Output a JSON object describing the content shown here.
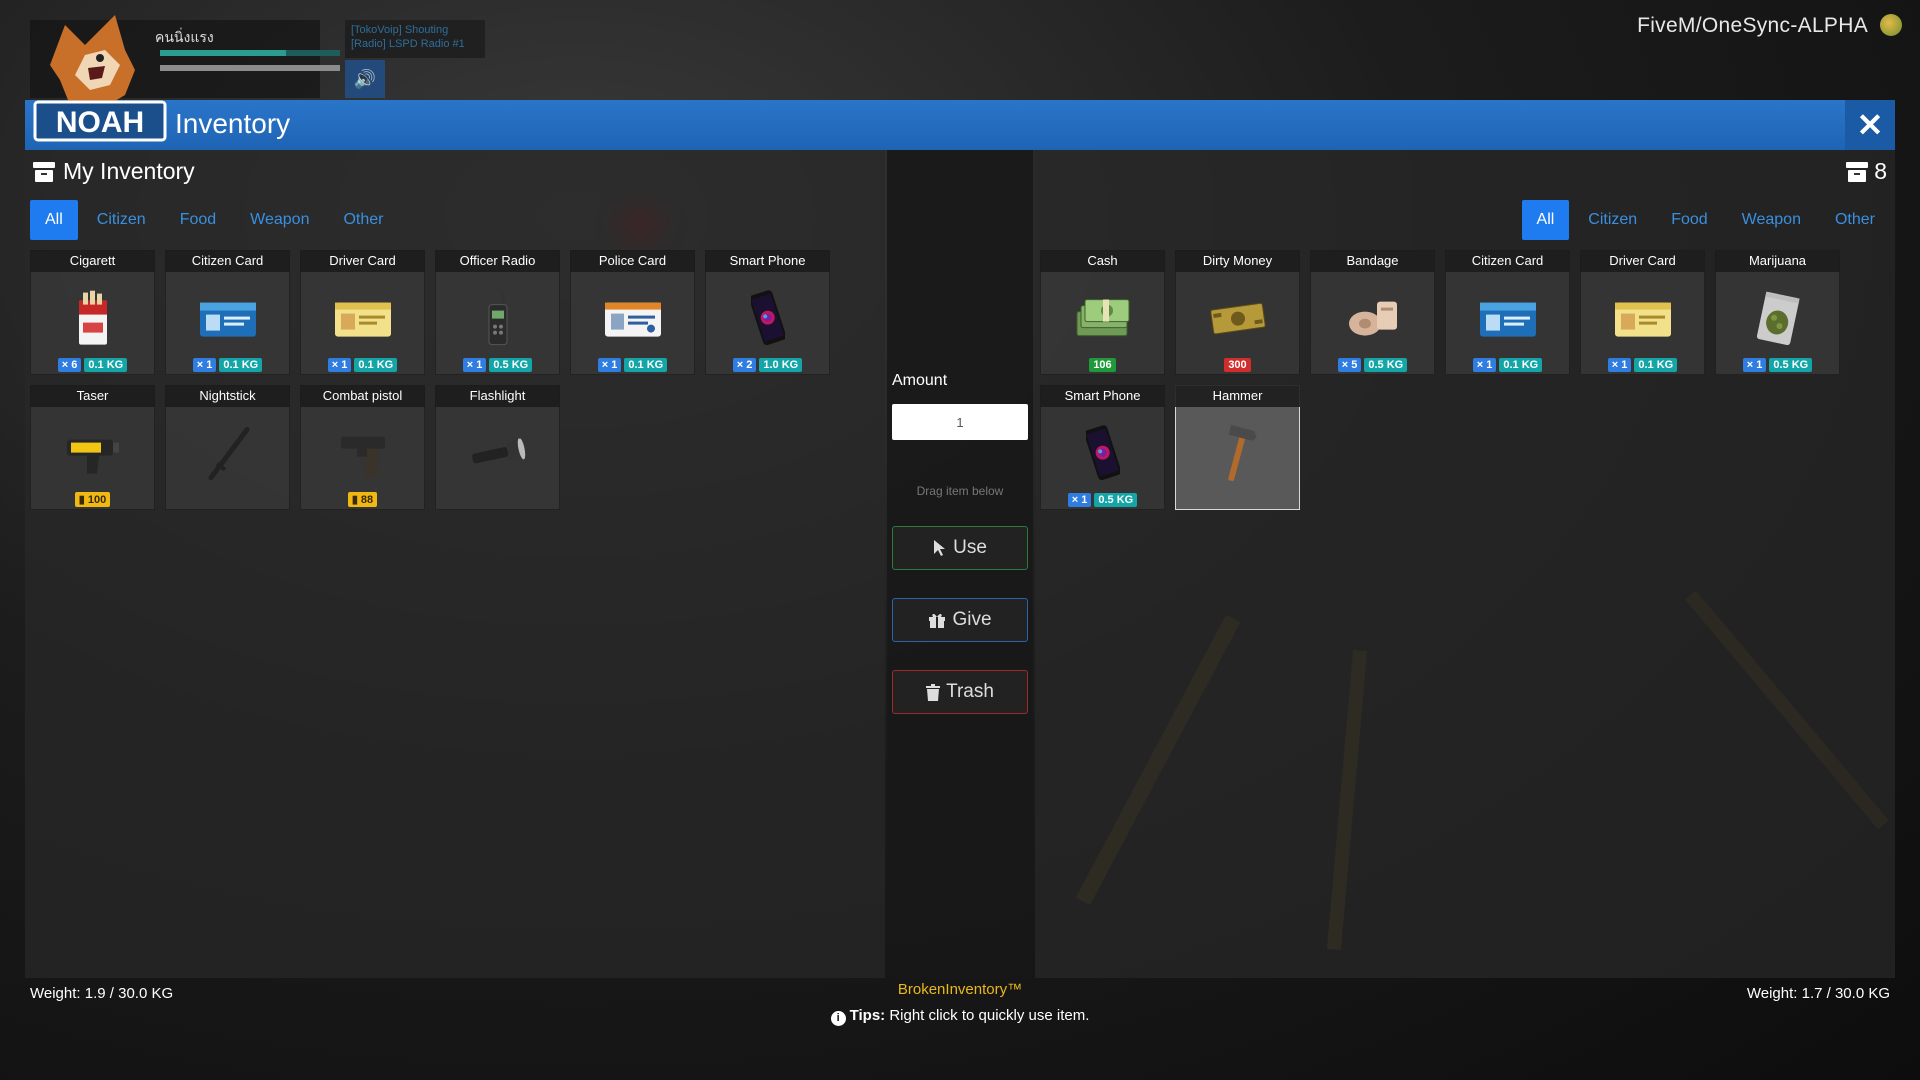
{
  "hud": {
    "player_name": "คนนิ่งแรง",
    "voice_line1": "[TokoVoip] Shouting",
    "voice_line2": "[Radio] LSPD Radio #1",
    "server_name": "FiveM/OneSync-ALPHA"
  },
  "logo": {
    "text": "NOAH"
  },
  "header": {
    "title": "Inventory",
    "close_label": "✕"
  },
  "left": {
    "title": "My Inventory",
    "tabs": [
      "All",
      "Citizen",
      "Food",
      "Weapon",
      "Other"
    ],
    "active_tab": "All",
    "weight": "Weight: 1.9 / 30.0 KG",
    "items": [
      {
        "name": "Cigarett",
        "icon": "cigarette-pack-icon",
        "qty": "× 6",
        "weight": "0.1 KG"
      },
      {
        "name": "Citizen Card",
        "icon": "citizen-card-icon",
        "qty": "× 1",
        "weight": "0.1 KG"
      },
      {
        "name": "Driver Card",
        "icon": "driver-card-icon",
        "qty": "× 1",
        "weight": "0.1 KG"
      },
      {
        "name": "Officer Radio",
        "icon": "radio-icon",
        "qty": "× 1",
        "weight": "0.5 KG"
      },
      {
        "name": "Police Card",
        "icon": "police-card-icon",
        "qty": "× 1",
        "weight": "0.1 KG"
      },
      {
        "name": "Smart Phone",
        "icon": "smartphone-icon",
        "qty": "× 2",
        "weight": "1.0 KG"
      },
      {
        "name": "Taser",
        "icon": "taser-icon",
        "ammo": "100"
      },
      {
        "name": "Nightstick",
        "icon": "nightstick-icon"
      },
      {
        "name": "Combat pistol",
        "icon": "pistol-icon",
        "ammo": "88"
      },
      {
        "name": "Flashlight",
        "icon": "flashlight-icon"
      }
    ]
  },
  "middle": {
    "amount_label": "Amount",
    "amount_value": "1",
    "drag_hint": "Drag item below",
    "use_label": "Use",
    "give_label": "Give",
    "trash_label": "Trash",
    "brand": "BrokenInventory™"
  },
  "right": {
    "count": "8",
    "tabs": [
      "All",
      "Citizen",
      "Food",
      "Weapon",
      "Other"
    ],
    "active_tab": "All",
    "weight": "Weight: 1.7 / 30.0 KG",
    "items": [
      {
        "name": "Cash",
        "icon": "cash-stack-icon",
        "money": "106",
        "money_color": "green"
      },
      {
        "name": "Dirty Money",
        "icon": "dirty-money-icon",
        "money": "300",
        "money_color": "red"
      },
      {
        "name": "Bandage",
        "icon": "bandage-icon",
        "qty": "× 5",
        "weight": "0.5 KG"
      },
      {
        "name": "Citizen Card",
        "icon": "citizen-card-icon",
        "qty": "× 1",
        "weight": "0.1 KG"
      },
      {
        "name": "Driver Card",
        "icon": "driver-card-icon",
        "qty": "× 1",
        "weight": "0.1 KG"
      },
      {
        "name": "Marijuana",
        "icon": "marijuana-bag-icon",
        "qty": "× 1",
        "weight": "0.5 KG"
      },
      {
        "name": "Smart Phone",
        "icon": "smartphone-icon",
        "qty": "× 1",
        "weight": "0.5 KG"
      },
      {
        "name": "Hammer",
        "icon": "hammer-icon",
        "selected": true
      }
    ]
  },
  "tips": {
    "label": "Tips:",
    "text": " Right click to quickly use item."
  },
  "colors": {
    "header_blue": "#1f64b4",
    "tab_active": "#1e7bf0",
    "qty_badge": "#2f7de0",
    "weight_badge": "#14a5a8",
    "ammo_badge": "#f0b814",
    "brand_gold": "#e8b81c"
  }
}
